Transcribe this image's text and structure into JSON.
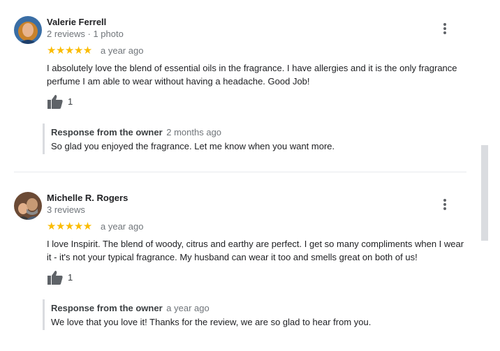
{
  "reviews": [
    {
      "name": "Valerie Ferrell",
      "meta": "2 reviews · 1 photo",
      "stars": "★★★★★",
      "rating": 5,
      "date": "a year ago",
      "text": "I absolutely love the blend of essential oils in the fragrance. I have allergies and it is the only fragrance perfume I am able to wear without having a headache. Good Job!",
      "likes": "1",
      "response": {
        "label": "Response from the owner",
        "date": "2 months ago",
        "text": "So glad you enjoyed the fragrance. Let me know when you want more."
      }
    },
    {
      "name": "Michelle R. Rogers",
      "meta": "3 reviews",
      "stars": "★★★★★",
      "rating": 5,
      "date": "a year ago",
      "text": "I love Inspirit. The blend of woody, citrus and earthy are perfect. I get so many compliments when I wear it - it's not your typical fragrance. My husband can wear it too and smells great on both of us!",
      "likes": "1",
      "response": {
        "label": "Response from the owner",
        "date": "a year ago",
        "text": "We love that you love it! Thanks for the review, we are so glad to hear from you."
      }
    }
  ],
  "colors": {
    "star": "#fbbc04",
    "secondary_text": "#70757a",
    "divider": "#e8eaed"
  },
  "icons": [
    "thumbs-up-icon",
    "more-vert-icon"
  ]
}
